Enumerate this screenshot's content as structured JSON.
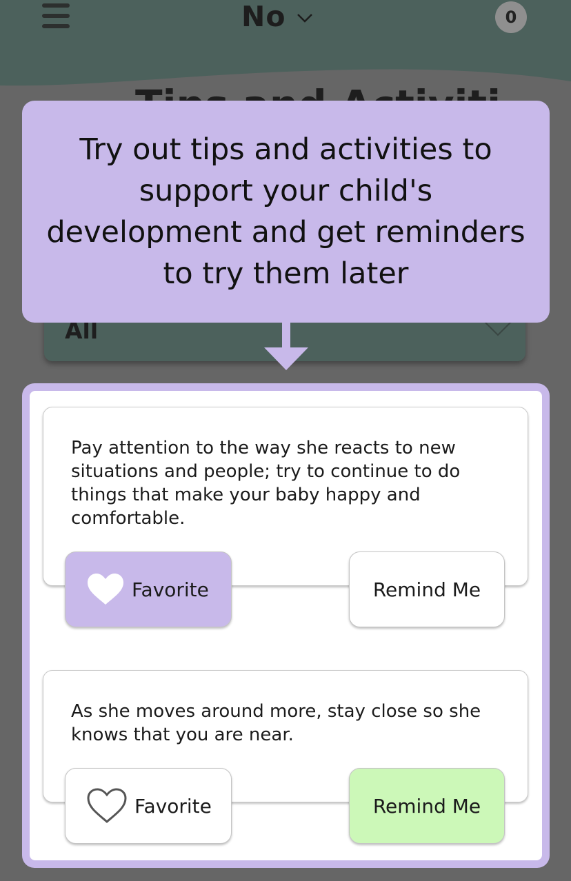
{
  "header": {
    "title": "No",
    "badge_count": "0",
    "background_color": "#4c615c"
  },
  "page": {
    "heading_partial": "Tips and Activiti",
    "filter_value": "All"
  },
  "tooltip": {
    "text": "Try out tips and activities to support your child's development and get reminders to try them later",
    "color": "#c8b9ea"
  },
  "cards": [
    {
      "text": "Pay attention to the way she reacts to new situations and people; try to continue to do things that make your baby happy and comfortable.",
      "favorite_label": "Favorite",
      "favorite_active": true,
      "remind_label": "Remind Me",
      "remind_active": false
    },
    {
      "text": "As she moves around more, stay close so she knows that you are near.",
      "favorite_label": "Favorite",
      "favorite_active": false,
      "remind_label": "Remind Me",
      "remind_active": true
    }
  ],
  "colors": {
    "favorite_active_bg": "#c8b9ea",
    "remind_active_bg": "#ccf8b8"
  },
  "icons": [
    "menu-icon",
    "chevron-down-icon",
    "heart-filled-icon",
    "heart-outline-icon",
    "down-arrow-icon"
  ]
}
